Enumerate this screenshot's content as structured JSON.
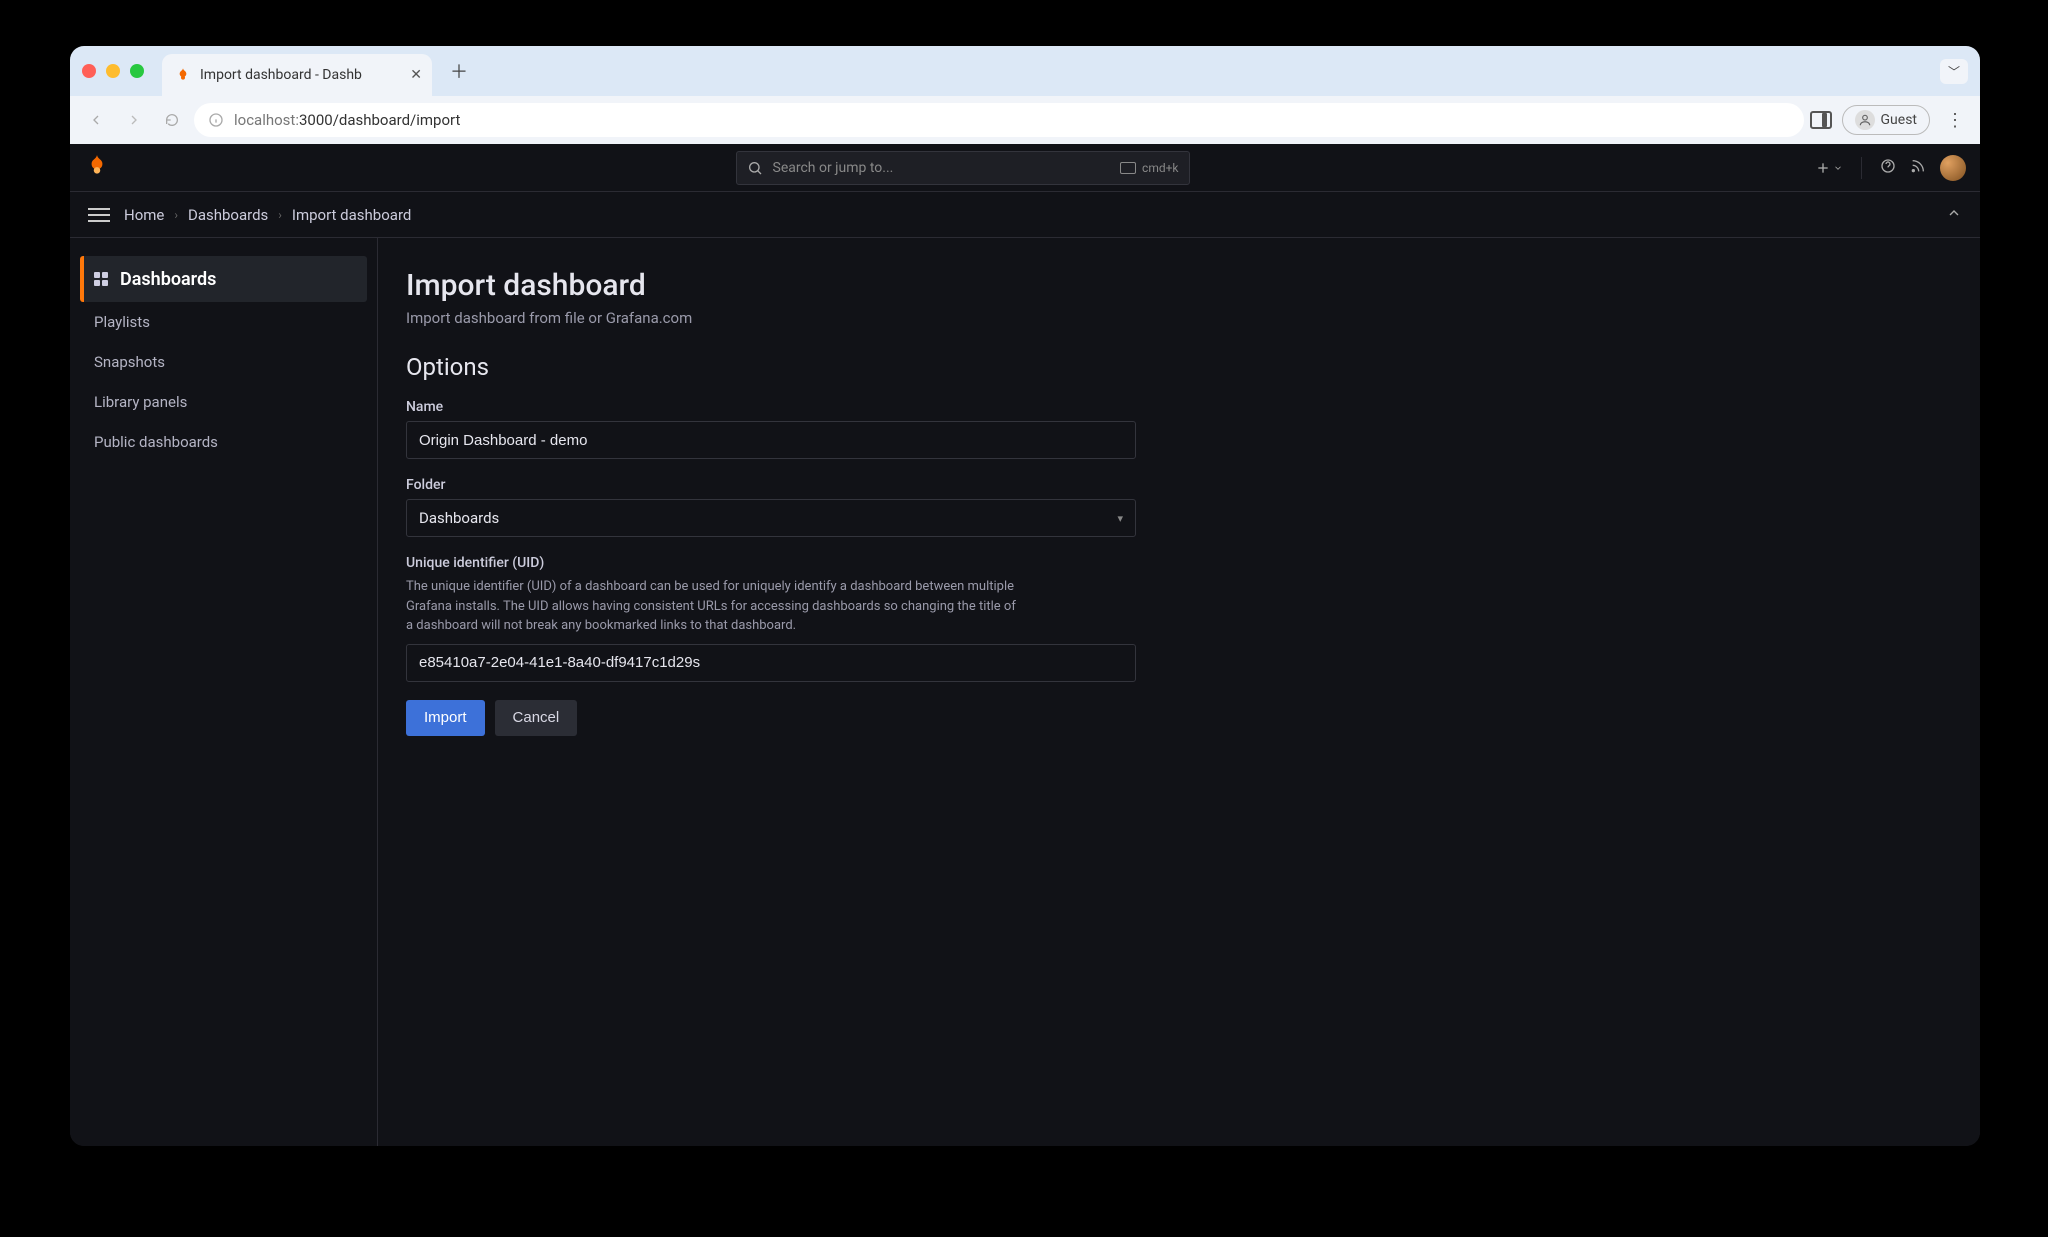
{
  "browser": {
    "tab_title": "Import dashboard - Dashb",
    "url_host": "localhost:",
    "url_port_path": "3000/dashboard/import",
    "guest_label": "Guest"
  },
  "topbar": {
    "search_placeholder": "Search or jump to...",
    "search_kbd": "cmd+k"
  },
  "breadcrumb": {
    "home": "Home",
    "dashboards": "Dashboards",
    "current": "Import dashboard"
  },
  "sidebar": {
    "main": "Dashboards",
    "items": [
      "Playlists",
      "Snapshots",
      "Library panels",
      "Public dashboards"
    ]
  },
  "page": {
    "title": "Import dashboard",
    "subtitle": "Import dashboard from file or Grafana.com",
    "options_heading": "Options",
    "name_label": "Name",
    "name_value": "Origin Dashboard - demo",
    "folder_label": "Folder",
    "folder_value": "Dashboards",
    "uid_label": "Unique identifier (UID)",
    "uid_help": "The unique identifier (UID) of a dashboard can be used for uniquely identify a dashboard between multiple Grafana installs. The UID allows having consistent URLs for accessing dashboards so changing the title of a dashboard will not break any bookmarked links to that dashboard.",
    "uid_value": "e85410a7-2e04-41e1-8a40-df9417c1d29s",
    "import_btn": "Import",
    "cancel_btn": "Cancel"
  }
}
